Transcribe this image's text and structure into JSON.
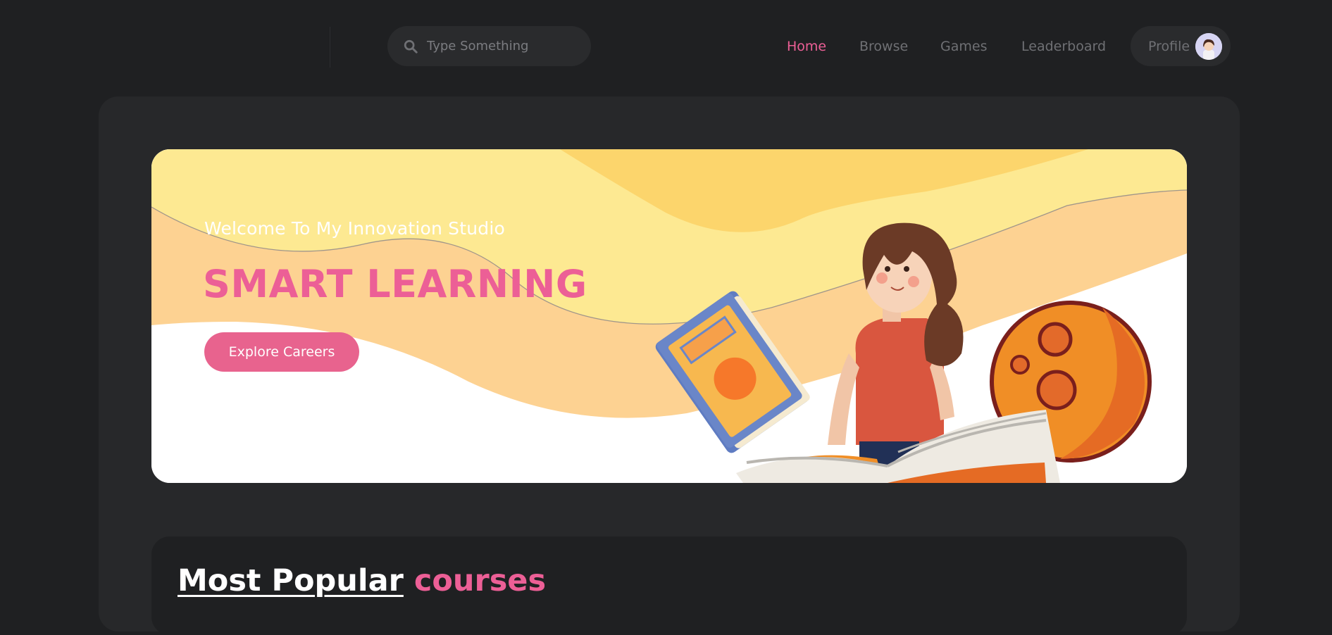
{
  "search": {
    "placeholder": "Type Something",
    "icon": "search-icon"
  },
  "nav": {
    "items": [
      {
        "label": "Home",
        "active": true
      },
      {
        "label": "Browse",
        "active": false
      },
      {
        "label": "Games",
        "active": false
      },
      {
        "label": "Leaderboard",
        "active": false
      }
    ],
    "profile_label": "Profile"
  },
  "banner": {
    "welcome": "Welcome To My Innovation Studio",
    "headline": "SMART LEARNING",
    "cta_label": "Explore Careers"
  },
  "popular": {
    "title_main": "Most Popular",
    "title_accent": "courses"
  },
  "colors": {
    "background": "#1f2022",
    "panel": "#27282a",
    "accent": "#ec5f96",
    "button": "#e8638e",
    "banner_yellow": "#fde992",
    "banner_peach": "#fdd292"
  }
}
